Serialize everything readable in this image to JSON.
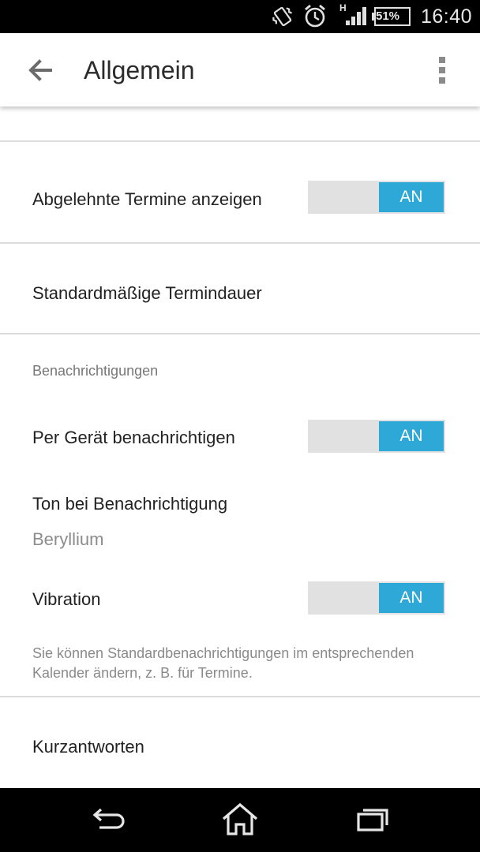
{
  "status_bar": {
    "time": "16:40",
    "battery": "51%",
    "network": "H",
    "icons": [
      "vibrate-icon",
      "alarm-icon",
      "signal-icon",
      "battery-icon"
    ]
  },
  "app_bar": {
    "title": "Allgemein",
    "back_icon": "arrow-left-icon",
    "menu_icon": "overflow-menu-icon"
  },
  "settings": {
    "declined_events": {
      "label": "Abgelehnte Termine anzeigen",
      "toggle": "AN"
    },
    "default_duration": {
      "label": "Standardmäßige Termindauer"
    },
    "notifications_header": "Benachrichtigungen",
    "notify_device": {
      "label": "Per Gerät benachrichtigen",
      "toggle": "AN"
    },
    "notification_sound": {
      "label": "Ton bei Benachrichtigung",
      "value": "Beryllium"
    },
    "vibration": {
      "label": "Vibration",
      "toggle": "AN"
    },
    "note": "Sie können Standardbenachrichtigungen im entsprechenden Kalender ändern, z. B. für Termine.",
    "quick_responses": {
      "label": "Kurzantworten"
    }
  },
  "colors": {
    "accent": "#2ea8d6",
    "toggle_track": "#e1e1e1",
    "divider": "#dcdcdc"
  },
  "nav_bar": {
    "icons": [
      "back-nav-icon",
      "home-nav-icon",
      "recents-nav-icon"
    ]
  }
}
